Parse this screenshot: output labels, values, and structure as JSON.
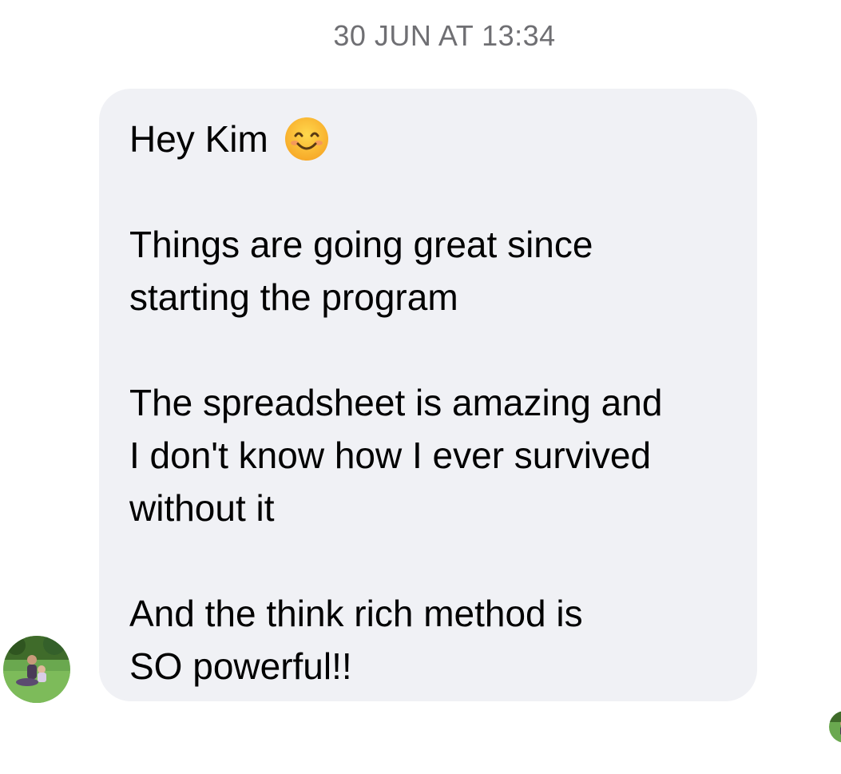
{
  "timestamp": "30 JUN AT 13:34",
  "message": {
    "greeting": "Hey Kim",
    "emoji": "smiling-face-emoji",
    "para1_line1": "Things are going great since",
    "para1_line2": "starting the program",
    "para2_line1": "The spreadsheet is amazing and",
    "para2_line2": "I don't know how I ever survived",
    "para2_line3": "without it",
    "para3_line1": "And the think rich method is",
    "para3_line2": "SO powerful!!"
  },
  "colors": {
    "bubble": "#f0f1f5",
    "timestamp": "#6f6f73",
    "text": "#000000"
  }
}
